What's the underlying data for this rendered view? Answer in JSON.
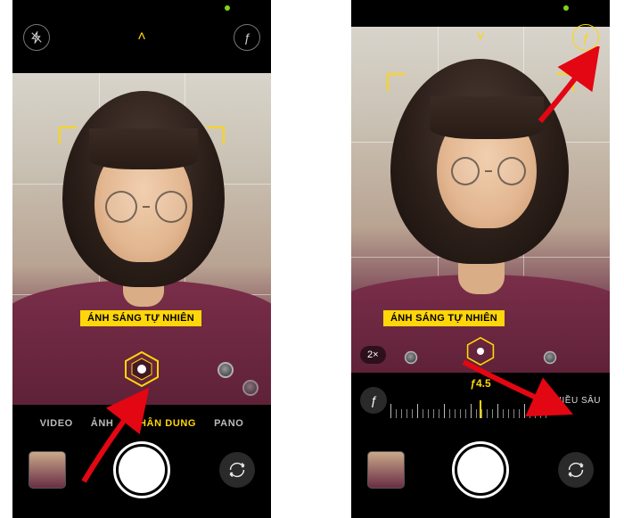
{
  "phone1": {
    "lighting_badge": "ÁNH SÁNG TỰ NHIÊN",
    "modes": {
      "video": "VIDEO",
      "photo": "ẢNH",
      "portrait": "CHÂN DUNG",
      "pano": "PANO"
    },
    "flash_icon": "flash-off-icon",
    "depth_icon": "f-depth-icon",
    "chevron": "˄"
  },
  "phone2": {
    "lighting_badge": "ÁNH SÁNG TỰ NHIÊN",
    "zoom": "2×",
    "chevron": "˅",
    "depth": {
      "value": "ƒ4.5",
      "label": "CHIỀU SÂU"
    }
  },
  "colors": {
    "accent": "#ffd60a"
  }
}
